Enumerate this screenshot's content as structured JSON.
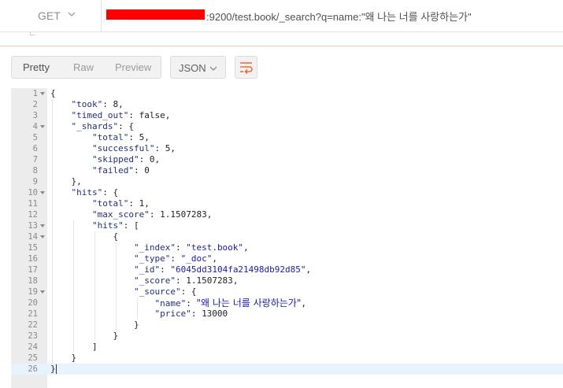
{
  "request": {
    "method": "GET",
    "url": ":9200/test.book/_search?q=name:\"왜 나는 너를 사랑하는가\""
  },
  "view_modes": [
    "Pretty",
    "Raw",
    "Preview"
  ],
  "active_view_mode": "Pretty",
  "format": "JSON",
  "icons": {
    "method_dropdown": "chevron-down-icon",
    "format_dropdown": "chevron-down-icon",
    "wrap": "wrap-lines-icon",
    "fold": "fold-arrow-icon"
  },
  "colors": {
    "wrap_icon": "#f26b3a",
    "redaction": "#ff0000",
    "json_key": "#232f7a",
    "json_string": "#1a1aa6"
  },
  "line_numbers": [
    "1",
    "2",
    "3",
    "4",
    "5",
    "6",
    "7",
    "8",
    "9",
    "10",
    "11",
    "12",
    "13",
    "14",
    "15",
    "16",
    "17",
    "18",
    "19",
    "20",
    "21",
    "22",
    "23",
    "24",
    "25",
    "26"
  ],
  "code": {
    "l1": "{",
    "l2_key": "\"took\"",
    "l2_val": "8",
    "l3_key": "\"timed_out\"",
    "l3_val": "false",
    "l4_key": "\"_shards\"",
    "l4_open": "{",
    "l5_key": "\"total\"",
    "l5_val": "5",
    "l6_key": "\"successful\"",
    "l6_val": "5",
    "l7_key": "\"skipped\"",
    "l7_val": "0",
    "l8_key": "\"failed\"",
    "l8_val": "0",
    "l9": "},",
    "l10_key": "\"hits\"",
    "l10_open": "{",
    "l11_key": "\"total\"",
    "l11_val": "1",
    "l12_key": "\"max_score\"",
    "l12_val": "1.1507283",
    "l13_key": "\"hits\"",
    "l13_open": "[",
    "l14": "{",
    "l15_key": "\"_index\"",
    "l15_val": "\"test.book\"",
    "l16_key": "\"_type\"",
    "l16_val": "\"_doc\"",
    "l17_key": "\"_id\"",
    "l17_val": "\"6045dd3104fa21498db92d85\"",
    "l18_key": "\"_score\"",
    "l18_val": "1.1507283",
    "l19_key": "\"_source\"",
    "l19_open": "{",
    "l20_key": "\"name\"",
    "l20_val": "\"왜 나는 너를 사랑하는가\"",
    "l21_key": "\"price\"",
    "l21_val": "13000",
    "l22": "}",
    "l23": "}",
    "l24": "]",
    "l25": "}",
    "l26": "}"
  }
}
